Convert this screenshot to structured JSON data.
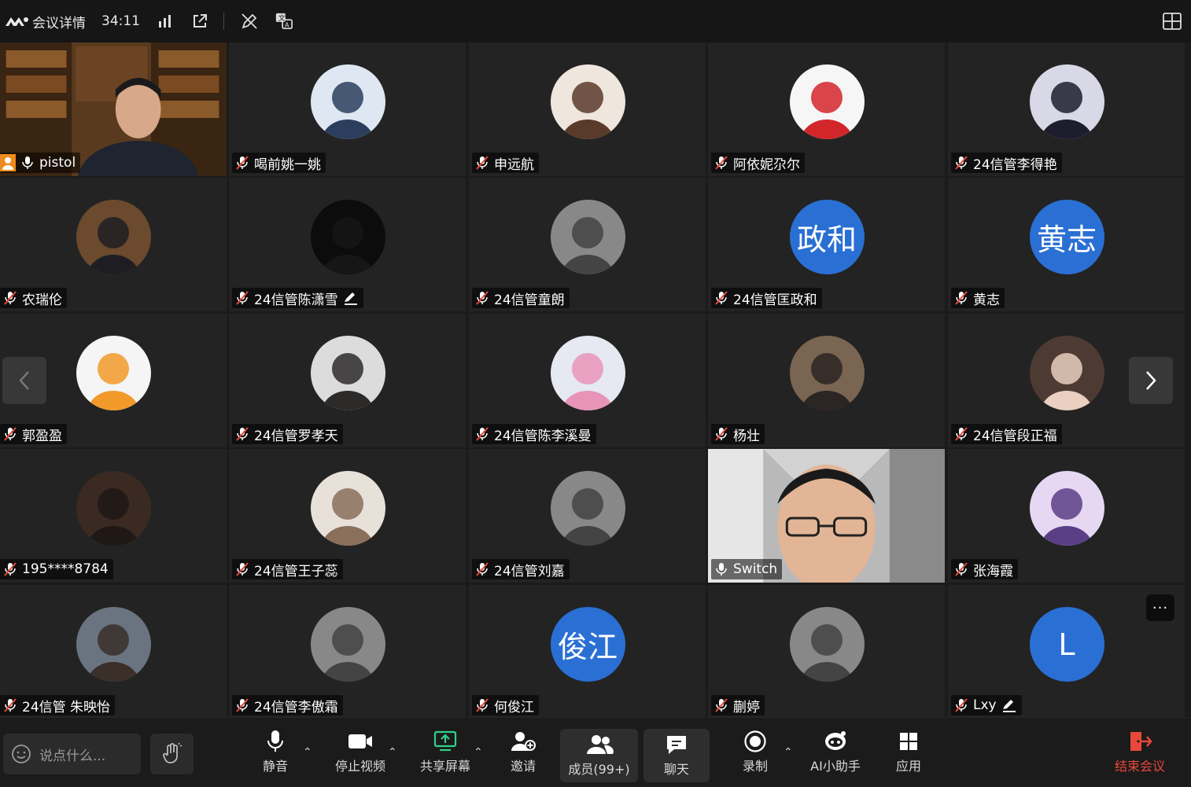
{
  "header": {
    "title": "会议详情",
    "timer": "34:11"
  },
  "participants": [
    {
      "name": "pistol",
      "type": "video",
      "mic": "on",
      "host": true
    },
    {
      "name": "喝前姚一姚",
      "type": "image",
      "mic": "muted"
    },
    {
      "name": "申远航",
      "type": "image",
      "mic": "muted"
    },
    {
      "name": "阿依妮尕尔",
      "type": "image",
      "mic": "muted"
    },
    {
      "name": "24信管李得艳",
      "type": "image",
      "mic": "muted"
    },
    {
      "name": "农瑞伦",
      "type": "image",
      "mic": "muted"
    },
    {
      "name": "24信管陈潇雪",
      "type": "image",
      "mic": "muted",
      "annotate": true
    },
    {
      "name": "24信管童朗",
      "type": "image",
      "mic": "muted"
    },
    {
      "name": "24信管匡政和",
      "type": "text",
      "avatar_text": "政和",
      "mic": "muted"
    },
    {
      "name": "黄志",
      "type": "text",
      "avatar_text": "黄志",
      "mic": "muted"
    },
    {
      "name": "郭盈盈",
      "type": "image",
      "mic": "muted"
    },
    {
      "name": "24信管罗孝天",
      "type": "image",
      "mic": "muted"
    },
    {
      "name": "24信管陈李溪曼",
      "type": "image",
      "mic": "muted"
    },
    {
      "name": "杨壮",
      "type": "image",
      "mic": "muted"
    },
    {
      "name": "24信管段正福",
      "type": "image",
      "mic": "muted"
    },
    {
      "name": "195****8784",
      "type": "image",
      "mic": "muted"
    },
    {
      "name": "24信管王子蕊",
      "type": "image",
      "mic": "muted"
    },
    {
      "name": "24信管刘嘉",
      "type": "image",
      "mic": "muted"
    },
    {
      "name": "Switch",
      "type": "video",
      "mic": "on",
      "active": true
    },
    {
      "name": "张海霞",
      "type": "image",
      "mic": "muted"
    },
    {
      "name": "24信管 朱映怡",
      "type": "image",
      "mic": "muted"
    },
    {
      "name": "24信管李傲霜",
      "type": "image",
      "mic": "muted"
    },
    {
      "name": "何俊江",
      "type": "text",
      "avatar_text": "俊江",
      "mic": "muted"
    },
    {
      "name": "蒯婷",
      "type": "image",
      "mic": "muted"
    },
    {
      "name": "Lxy",
      "type": "text",
      "avatar_text": "L",
      "mic": "muted",
      "annotate": true
    }
  ],
  "toolbar": {
    "chat_placeholder": "说点什么...",
    "mute": "静音",
    "stop_video": "停止视频",
    "share_screen": "共享屏幕",
    "invite": "邀请",
    "members": "成员(99+)",
    "chat": "聊天",
    "record": "录制",
    "ai_assistant": "AI小助手",
    "apps": "应用",
    "end_meeting": "结束会议"
  },
  "colors": {
    "active_border": "#2fd18a",
    "text_avatar": "#2a6fd4",
    "end_red": "#e8483a",
    "share_green": "#2fd18a"
  }
}
